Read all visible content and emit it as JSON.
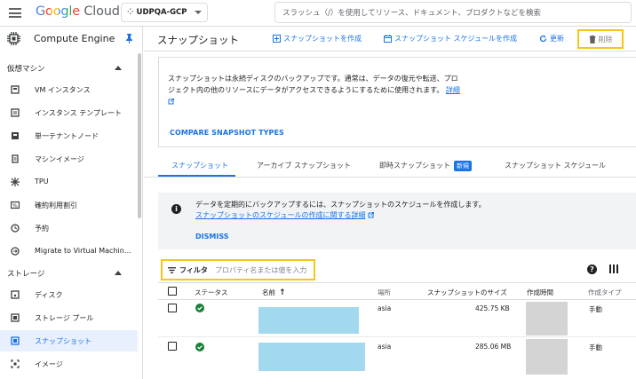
{
  "header": {
    "brand_google": "Google",
    "brand_cloud": "Cloud",
    "project": "UDPQA-GCP",
    "search_placeholder": "スラッシュ（/）を使用してリソース、ドキュメント、プロダクトなどを検索"
  },
  "sidebar": {
    "product": "Compute Engine",
    "sections": [
      {
        "label": "仮想マシン",
        "items": [
          {
            "label": "VM インスタンス",
            "icon": "vm-icon"
          },
          {
            "label": "インスタンス テンプレート",
            "icon": "template-icon"
          },
          {
            "label": "単一テナントノード",
            "icon": "node-icon"
          },
          {
            "label": "マシンイメージ",
            "icon": "machine-image-icon"
          },
          {
            "label": "TPU",
            "icon": "tpu-icon"
          },
          {
            "label": "確約利用割引",
            "icon": "discount-icon"
          },
          {
            "label": "予約",
            "icon": "reservation-icon"
          },
          {
            "label": "Migrate to Virtual Machin…",
            "icon": "migrate-icon"
          }
        ]
      },
      {
        "label": "ストレージ",
        "items": [
          {
            "label": "ディスク",
            "icon": "disk-icon"
          },
          {
            "label": "ストレージ プール",
            "icon": "storage-pool-icon"
          },
          {
            "label": "スナップショット",
            "icon": "snapshot-icon",
            "active": true
          },
          {
            "label": "イメージ",
            "icon": "image-icon"
          }
        ]
      }
    ]
  },
  "page": {
    "title": "スナップショット",
    "actions": {
      "create_snapshot": "スナップショットを作成",
      "create_schedule": "スナップショット スケジュールを作成",
      "refresh": "更新",
      "delete": "削除"
    }
  },
  "info": {
    "text": "スナップショットは永続ディスクのバックアップです。通常は、データの復元や転送、プロジェクト内の他のリソースにデータがアクセスできるようにするために使用されます。",
    "link": "詳細",
    "compare": "COMPARE SNAPSHOT TYPES"
  },
  "tabs": [
    {
      "label": "スナップショット",
      "active": true
    },
    {
      "label": "アーカイブ スナップショット"
    },
    {
      "label": "即時スナップショット",
      "badge": "新規"
    },
    {
      "label": "スナップショット スケジュール"
    }
  ],
  "banner": {
    "text": "データを定期的にバックアップするには、スナップショットのスケジュールを作成します。",
    "link": "スナップショットのスケジュールの作成に関する詳細",
    "dismiss": "DISMISS"
  },
  "filter": {
    "label": "フィルタ",
    "placeholder": "プロパティ名または値を入力"
  },
  "table": {
    "columns": [
      "ステータス",
      "名前",
      "場所",
      "スナップショットのサイズ",
      "作成時間",
      "作成タイプ"
    ],
    "sort_indicator": "↑",
    "rows": [
      {
        "location": "asia",
        "size": "425.75 KB",
        "type": "手動"
      },
      {
        "location": "asia",
        "size": "285.06 MB",
        "type": "手動"
      }
    ]
  },
  "colors": {
    "accent": "#1a73e8",
    "highlight": "#f5c518",
    "status_ok": "#188038"
  }
}
